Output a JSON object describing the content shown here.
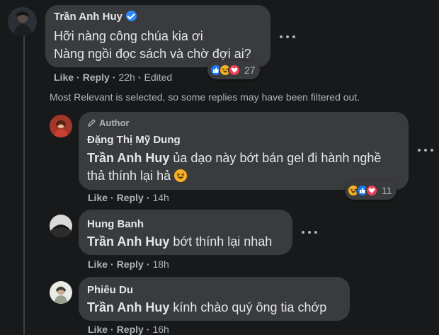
{
  "main_comment": {
    "author": "Trần Anh Huy",
    "line1": "Hỡi nàng công chúa kia ơi",
    "line2": "Nàng ngồi đọc sách và chờ đợi ai?",
    "like": "Like",
    "reply": "Reply",
    "time": "22h",
    "edited": "Edited",
    "reaction_count": "27",
    "reactions": [
      "like-icon",
      "haha-icon",
      "love-icon"
    ]
  },
  "filter_notice": "Most Relevant is selected, so some replies may have been filtered out.",
  "replies": [
    {
      "badge": "Author",
      "author": "Đặng Thị Mỹ Dung",
      "mention": "Trần Anh Huy",
      "line1": "ủa dạo này bớt bán gel đi hành nghề",
      "line2": "thả thính lại hả",
      "emoji": "😆",
      "like": "Like",
      "reply": "Reply",
      "time": "14h",
      "reaction_count": "11",
      "reactions": [
        "haha-icon",
        "like-icon",
        "love-icon"
      ]
    },
    {
      "author": "Hung Banh",
      "mention": "Trần Anh Huy",
      "text": "bớt thính lại nhah",
      "like": "Like",
      "reply": "Reply",
      "time": "18h"
    },
    {
      "author": "Phiêu Du",
      "mention": "Trần Anh Huy",
      "text": "kính chào quý ông tia chớp",
      "like": "Like",
      "reply": "Reply",
      "time": "16h"
    }
  ],
  "colors": {
    "background": "#18191a",
    "bubble": "#3a3b3c",
    "text": "#e4e6eb",
    "secondary": "#b0b3b8",
    "like_blue": "#1877f2",
    "love_red": "#f33e58",
    "haha_yellow": "#f7b125",
    "verified_blue": "#2d88ff"
  }
}
